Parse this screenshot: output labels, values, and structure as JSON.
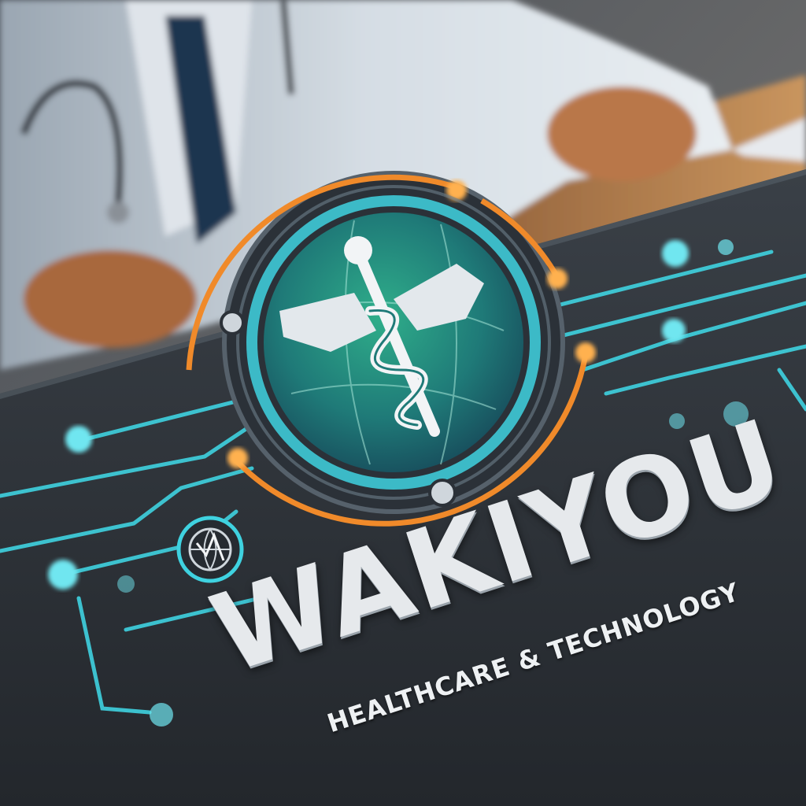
{
  "brand": {
    "name": "WAKIYOU",
    "tagline": "HEALTHCARE & TECHNOLOGY"
  },
  "icons": {
    "emblem": "caduceus-globe-icon",
    "small_badge": "globe-icon"
  },
  "colors": {
    "background": "#2c3036",
    "teal": "#3fd2e0",
    "green": "#2fae8a",
    "orange": "#f08a2a",
    "text": "#e6e9ec"
  }
}
